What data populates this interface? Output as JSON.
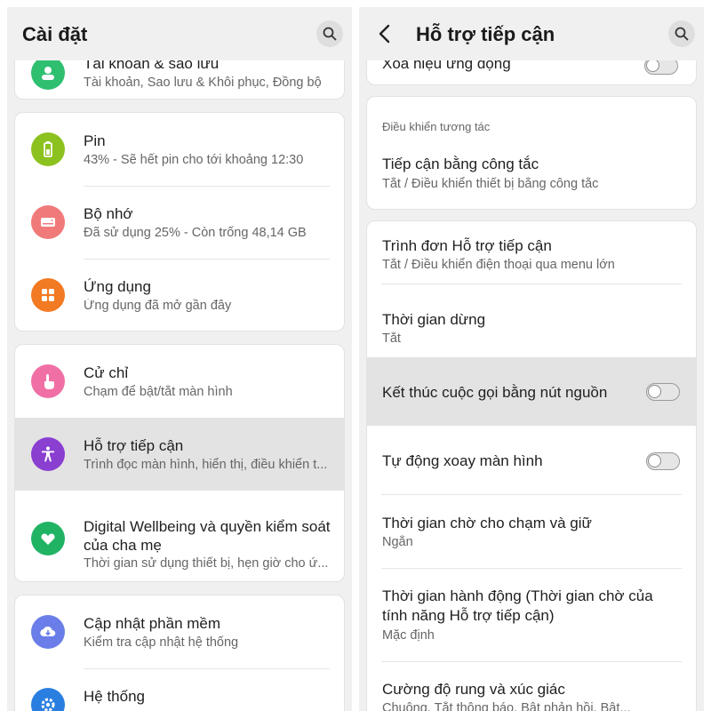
{
  "left": {
    "title": "Cài đặt",
    "account": {
      "title": "Tài khoản & sao lưu",
      "subtitle": "Tài khoản, Sao lưu & Khôi phục, Đồng bộ",
      "color": "#2fbf71"
    },
    "items": [
      {
        "title": "Pin",
        "subtitle": "43% - Sẽ hết pin cho tới khoảng 12:30",
        "icon": "battery-icon",
        "color": "#8cc21f"
      },
      {
        "title": "Bộ nhớ",
        "subtitle": "Đã sử dụng 25% - Còn trống 48,14 GB",
        "icon": "storage-icon",
        "color": "#f07a7a"
      },
      {
        "title": "Ứng dụng",
        "subtitle": "Ứng dụng đã mở gần đây",
        "icon": "apps-icon",
        "color": "#f17a22"
      },
      {
        "title": "Cử chỉ",
        "subtitle": "Chạm để bật/tắt màn hình",
        "icon": "gesture-icon",
        "color": "#f06fa5"
      },
      {
        "title": "Hỗ trợ tiếp cận",
        "subtitle": "Trình đọc màn hình, hiển thị, điều khiển t...",
        "icon": "accessibility-icon",
        "color": "#8a3fd1"
      },
      {
        "title": "Digital Wellbeing và quyền kiểm soát của cha mẹ",
        "subtitle": "Thời gian sử dụng thiết bị, hẹn giờ cho ứ...",
        "icon": "wellbeing-icon",
        "color": "#21b364"
      },
      {
        "title": "Cập nhật phần mềm",
        "subtitle": "Kiểm tra cập nhật hệ thống",
        "icon": "cloud-download-icon",
        "color": "#6a7de8"
      },
      {
        "title": "Hệ thống",
        "subtitle": "",
        "icon": "gear-icon",
        "color": "#2a7ee0"
      }
    ]
  },
  "right": {
    "title": "Hỗ trợ tiếp cận",
    "top_item": {
      "title": "Xóa hiệu ứng động"
    },
    "section_header": "Điều khiển tương tác",
    "items": [
      {
        "title": "Tiếp cận bằng công tắc",
        "subtitle": "Tắt / Điều khiển thiết bị bằng công tắc"
      },
      {
        "title": "Trình đơn Hỗ trợ tiếp cận",
        "subtitle": "Tắt / Điều khiển điện thoại qua menu lớn"
      },
      {
        "title": "Thời gian dừng",
        "subtitle": "Tắt"
      },
      {
        "title": "Kết thúc cuộc gọi bằng nút nguồn",
        "toggle": "off"
      },
      {
        "title": "Tự động xoay màn hình",
        "toggle": "off"
      },
      {
        "title": "Thời gian chờ cho chạm và giữ",
        "subtitle": "Ngắn"
      },
      {
        "title_line1": "Thời gian hành động (Thời gian chờ của",
        "title_line2": "tính năng Hỗ trợ tiếp cận)",
        "subtitle": "Mặc định"
      },
      {
        "title": "Cường độ rung và xúc giác",
        "subtitle": "Chuông, Tắt thông báo, Bật phản hồi, Bật..."
      }
    ]
  }
}
